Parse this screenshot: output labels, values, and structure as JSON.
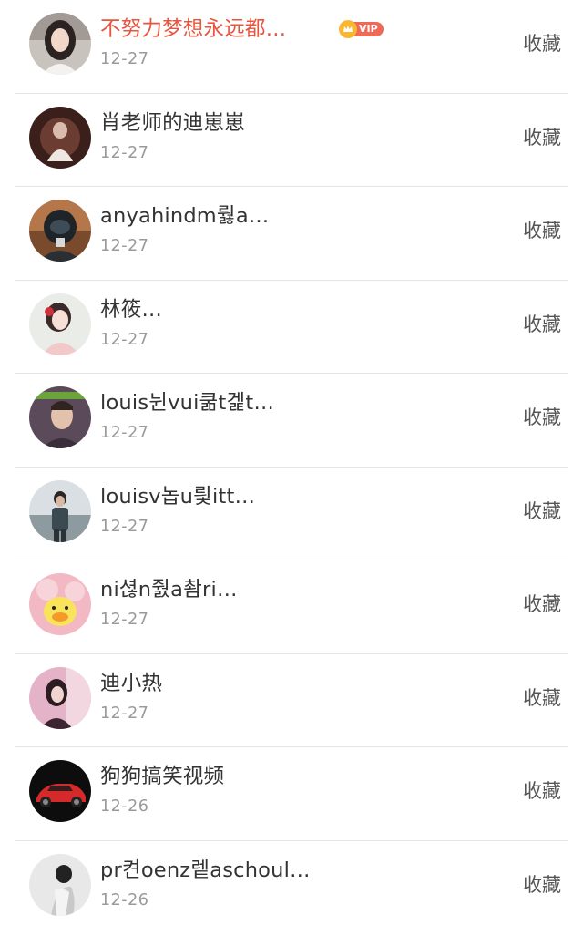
{
  "list": [
    {
      "name": "不努力梦想永远都…",
      "date": "12-27",
      "vip": true,
      "vip_label": "VIP",
      "action": "收藏",
      "avatar_icon": "avatar-girl-longhair"
    },
    {
      "name": "肖老师的迪崽崽",
      "date": "12-27",
      "vip": false,
      "action": "收藏",
      "avatar_icon": "avatar-dark-portrait"
    },
    {
      "name": "anyahindm뤓a…",
      "date": "12-27",
      "vip": false,
      "action": "收藏",
      "avatar_icon": "avatar-helmet"
    },
    {
      "name": "林筱…",
      "date": "12-27",
      "vip": false,
      "action": "收藏",
      "avatar_icon": "avatar-illustrated-girl"
    },
    {
      "name": "louis뉜vui쿪t겙t…",
      "date": "12-27",
      "vip": false,
      "action": "收藏",
      "avatar_icon": "avatar-man-portrait"
    },
    {
      "name": "louisv놉u릧itt…",
      "date": "12-27",
      "vip": false,
      "action": "收藏",
      "avatar_icon": "avatar-man-standing"
    },
    {
      "name": "ni셚n줤a촴ri…",
      "date": "12-27",
      "vip": false,
      "action": "收藏",
      "avatar_icon": "avatar-duck-toy"
    },
    {
      "name": "迪小热",
      "date": "12-27",
      "vip": false,
      "action": "收藏",
      "avatar_icon": "avatar-pink-girl"
    },
    {
      "name": "狗狗搞笑视频",
      "date": "12-26",
      "vip": false,
      "action": "收藏",
      "avatar_icon": "avatar-red-car"
    },
    {
      "name": "pr켠oenz렡aschoul…",
      "date": "12-26",
      "vip": false,
      "action": "收藏",
      "avatar_icon": "avatar-bw-figure"
    }
  ],
  "colors": {
    "vip_name": "#e8553f",
    "name": "#333333",
    "date": "#9a9a9a",
    "action": "#555555",
    "vip_badge": "#ee6a57",
    "vip_crown": "#f7b733"
  }
}
